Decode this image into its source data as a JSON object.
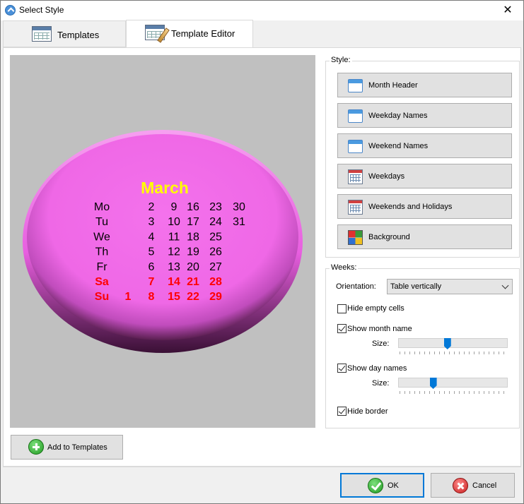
{
  "window": {
    "title": "Select Style",
    "close_glyph": "✕"
  },
  "tabs": [
    {
      "label": "Templates",
      "icon": "table-icon",
      "active": false
    },
    {
      "label": "Template Editor",
      "icon": "brush-table-icon",
      "active": true
    }
  ],
  "preview": {
    "background_color": "#c0c0c0",
    "shape_color": "#f06ae8",
    "month": "March",
    "month_color": "#ffff00",
    "rows": [
      {
        "day": "Mo",
        "dates": [
          "",
          "2",
          "9",
          "16",
          "23",
          "30"
        ],
        "weekend": false
      },
      {
        "day": "Tu",
        "dates": [
          "",
          "3",
          "10",
          "17",
          "24",
          "31"
        ],
        "weekend": false
      },
      {
        "day": "We",
        "dates": [
          "",
          "4",
          "11",
          "18",
          "25",
          ""
        ],
        "weekend": false
      },
      {
        "day": "Th",
        "dates": [
          "",
          "5",
          "12",
          "19",
          "26",
          ""
        ],
        "weekend": false
      },
      {
        "day": "Fr",
        "dates": [
          "",
          "6",
          "13",
          "20",
          "27",
          ""
        ],
        "weekend": false
      },
      {
        "day": "Sa",
        "dates": [
          "",
          "7",
          "14",
          "21",
          "28",
          ""
        ],
        "weekend": true
      },
      {
        "day": "Su",
        "dates": [
          "1",
          "8",
          "15",
          "22",
          "29",
          ""
        ],
        "weekend": true
      }
    ],
    "weekend_color": "#ff0000"
  },
  "style_group": {
    "title": "Style:",
    "buttons": [
      {
        "label": "Month Header",
        "icon": "window-icon"
      },
      {
        "label": "Weekday Names",
        "icon": "window-icon"
      },
      {
        "label": "Weekend Names",
        "icon": "window-icon"
      },
      {
        "label": "Weekdays",
        "icon": "calendar-icon"
      },
      {
        "label": "Weekends and Holidays",
        "icon": "calendar-icon"
      },
      {
        "label": "Background",
        "icon": "color-grid-icon"
      }
    ]
  },
  "weeks_group": {
    "title": "Weeks:",
    "orientation_label": "Orientation:",
    "orientation_value": "Table vertically",
    "hide_empty_cells": {
      "label": "Hide empty cells",
      "checked": false
    },
    "show_month_name": {
      "label": "Show month name",
      "checked": true
    },
    "month_size_label": "Size:",
    "month_size_value": 0.45,
    "show_day_names": {
      "label": "Show day names",
      "checked": true
    },
    "day_size_label": "Size:",
    "day_size_value": 0.32,
    "hide_border": {
      "label": "Hide border",
      "checked": true
    }
  },
  "add_to_templates": "Add to Templates",
  "ok": "OK",
  "cancel": "Cancel"
}
